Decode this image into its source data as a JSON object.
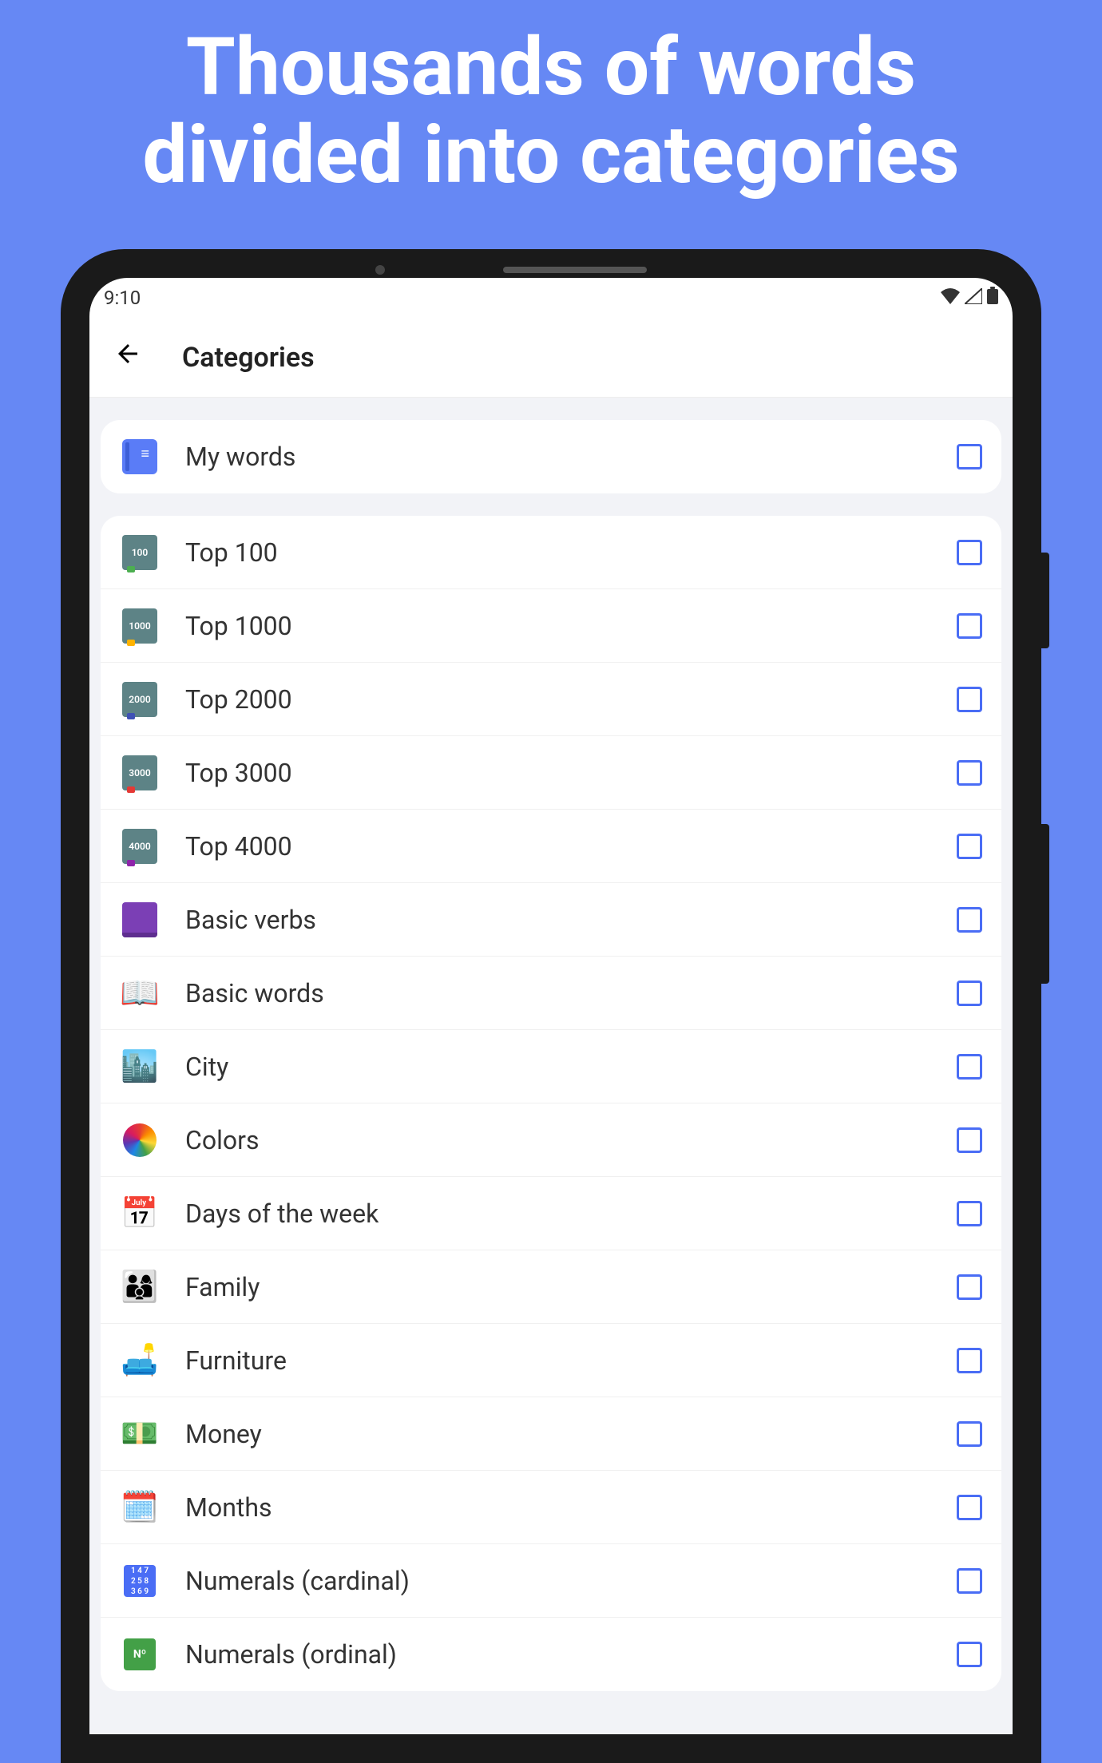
{
  "promo": {
    "line1": "Thousands of words",
    "line2": "divided into categories"
  },
  "statusbar": {
    "time": "9:10"
  },
  "appbar": {
    "title": "Categories"
  },
  "my_words": {
    "label": "My words",
    "checked": false
  },
  "categories": [
    {
      "label": "Top 100",
      "icon": "book-100",
      "badge": "100"
    },
    {
      "label": "Top 1000",
      "icon": "book-1000",
      "badge": "1000"
    },
    {
      "label": "Top 2000",
      "icon": "book-2000",
      "badge": "2000"
    },
    {
      "label": "Top 3000",
      "icon": "book-3000",
      "badge": "3000"
    },
    {
      "label": "Top 4000",
      "icon": "book-4000",
      "badge": "4000"
    },
    {
      "label": "Basic verbs",
      "icon": "purple-book",
      "badge": ""
    },
    {
      "label": "Basic words",
      "icon": "open-book",
      "badge": ""
    },
    {
      "label": "City",
      "icon": "city",
      "badge": ""
    },
    {
      "label": "Colors",
      "icon": "colors",
      "badge": ""
    },
    {
      "label": "Days of the week",
      "icon": "calendar-days",
      "badge": ""
    },
    {
      "label": "Family",
      "icon": "family",
      "badge": ""
    },
    {
      "label": "Furniture",
      "icon": "furniture",
      "badge": ""
    },
    {
      "label": "Money",
      "icon": "money",
      "badge": ""
    },
    {
      "label": "Months",
      "icon": "calendar-months",
      "badge": ""
    },
    {
      "label": "Numerals (cardinal)",
      "icon": "numerals-card",
      "badge": ""
    },
    {
      "label": "Numerals (ordinal)",
      "icon": "numerals-ord",
      "badge": ""
    }
  ]
}
